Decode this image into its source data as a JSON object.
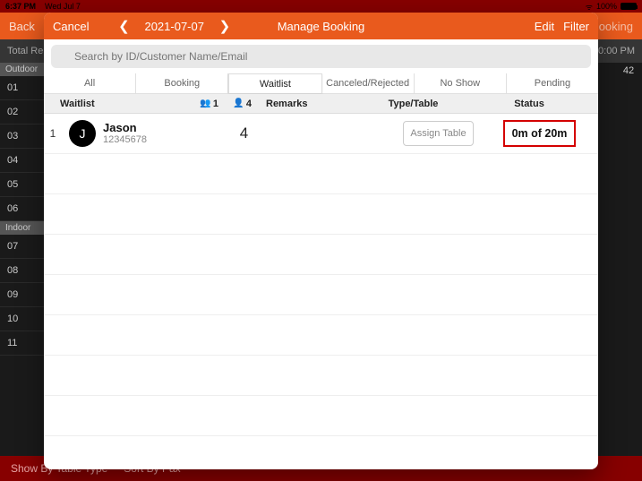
{
  "status_bar": {
    "time": "6:37 PM",
    "date": "Wed Jul 7",
    "battery": "100%"
  },
  "underlay": {
    "back": "Back",
    "booking": "ooking",
    "total": "Total Re",
    "right_time": "0:00 PM",
    "right_overflow": "42",
    "sections": {
      "outdoor": "Outdoor",
      "indoor": "Indoor",
      "outdoor_rows": [
        "01",
        "02",
        "03",
        "04",
        "05",
        "06"
      ],
      "indoor_rows": [
        "07",
        "08",
        "09",
        "10",
        "11"
      ]
    },
    "bottom": {
      "show_by": "Show By Table Type",
      "sort_by": "Sort By Pax"
    }
  },
  "modal": {
    "cancel": "Cancel",
    "date": "2021-07-07",
    "title": "Manage Booking",
    "edit": "Edit",
    "filter": "Filter",
    "search_placeholder": "Search by ID/Customer Name/Email",
    "tabs": [
      "All",
      "Booking",
      "Waitlist",
      "Canceled/Rejected",
      "No Show",
      "Pending"
    ],
    "active_tab_index": 2,
    "columns": {
      "waitlist": "Waitlist",
      "party_count": "1",
      "pax_count": "4",
      "remarks": "Remarks",
      "type_table": "Type/Table",
      "status": "Status"
    },
    "rows": [
      {
        "idx": "1",
        "initial": "J",
        "name": "Jason",
        "phone": "12345678",
        "pax": "4",
        "assign": "Assign Table",
        "status": "0m of 20m"
      }
    ]
  }
}
